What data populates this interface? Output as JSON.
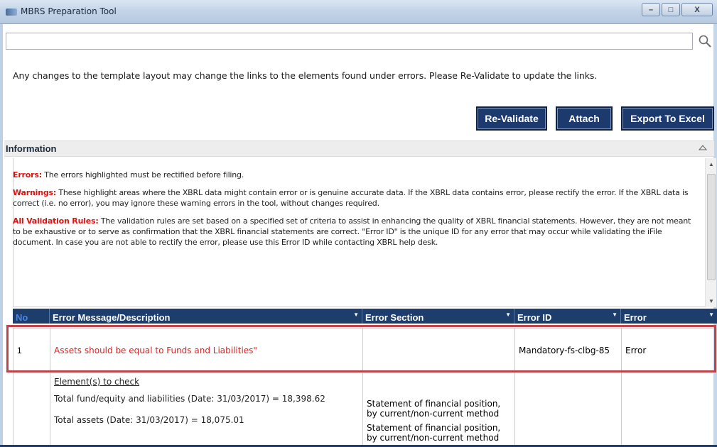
{
  "window": {
    "title": "MBRS Preparation Tool",
    "minimize_glyph": "–",
    "maximize_glyph": "□",
    "close_glyph": "X"
  },
  "search": {
    "value": "",
    "placeholder": "",
    "icon": "search-icon"
  },
  "notice": "Any changes to the template layout may change the links to the elements found under errors. Please Re-Validate to update the links.",
  "toolbar": {
    "revalidate_label": "Re-Validate",
    "attach_label": "Attach",
    "export_label": "Export To Excel"
  },
  "info": {
    "header": "Information",
    "errors_key": "Errors:",
    "errors_text": " The errors highlighted must be rectified before filing.",
    "warnings_key": "Warnings:",
    "warnings_text": " These highlight areas where the XBRL data might contain error or is genuine accurate data. If the XBRL data contains error, please rectify the error. If the XBRL data is correct (i.e. no error), you may ignore these warning errors in the tool, without changes required.",
    "rules_key": "All Validation Rules:",
    "rules_text": " The validation rules are set based on a specified set of criteria to assist in enhancing the quality of XBRL financial statements. However, they are not meant to be exhaustive or to serve as confirmation that the XBRL financial statements are correct. \"Error ID\" is the unique ID for any error that may occur while validating the iFile document. In case you are not able to rectify the error, please use this Error ID while contacting XBRL help desk."
  },
  "table": {
    "columns": [
      "No",
      "Error Message/Description",
      "Error Section",
      "Error ID",
      "Error"
    ],
    "rows": [
      {
        "no": "1",
        "message": "Assets should be equal to Funds and Liabilities\"",
        "section": "",
        "error_id": "Mandatory-fs-clbg-85",
        "error": "Error"
      }
    ],
    "details": {
      "title": "Element(s) to check",
      "items": [
        "Total fund/equity and liabilities (Date: 31/03/2017) = 18,398.62",
        "Total assets (Date: 31/03/2017) = 18,075.01"
      ],
      "sections": [
        "Statement of financial position, by current/non-current method",
        "Statement of financial position, by current/non-current method"
      ]
    }
  },
  "colors": {
    "header_bg": "#1d3d6d",
    "error_red": "#e02020",
    "highlight": "#c0424a"
  }
}
